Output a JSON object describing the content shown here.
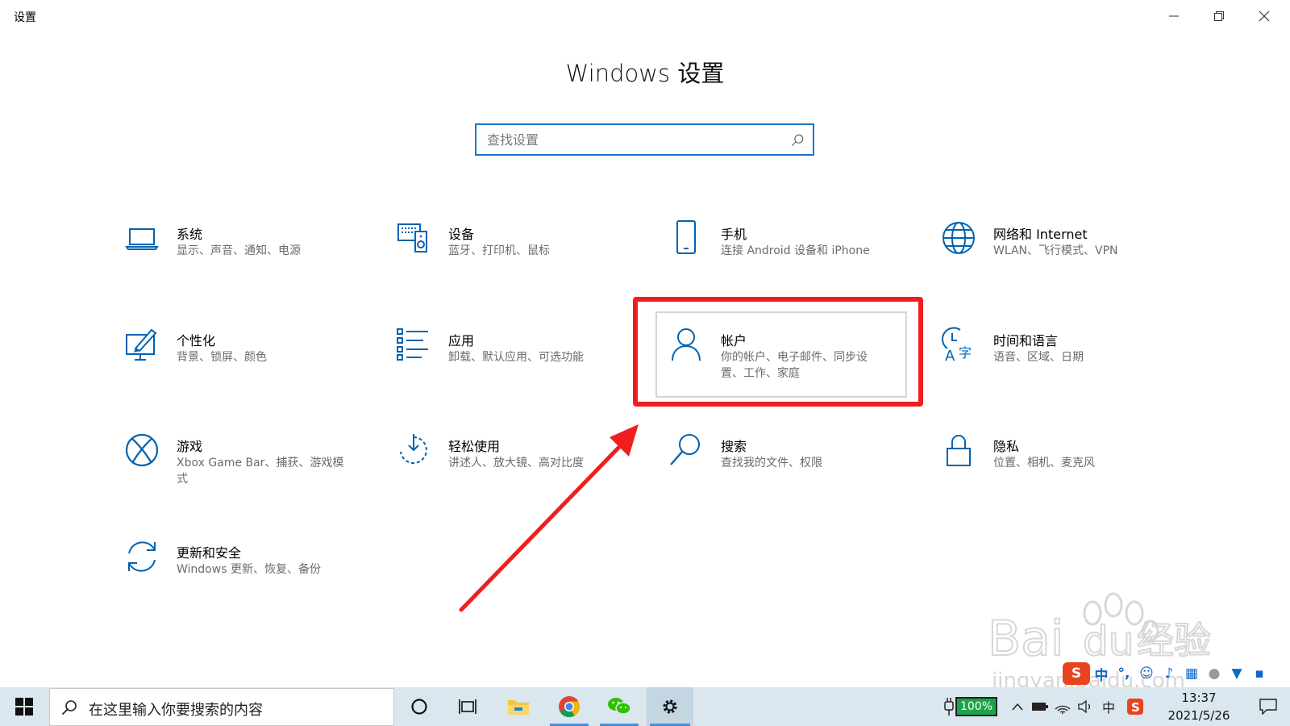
{
  "window": {
    "title": "设置",
    "minimize_icon": "minimize-icon",
    "restore_icon": "restore-icon",
    "close_icon": "close-icon"
  },
  "heading": "Windows 设置",
  "search": {
    "placeholder": "查找设置"
  },
  "tiles": [
    {
      "name": "系统",
      "desc": "显示、声音、通知、电源",
      "icon": "laptop-icon"
    },
    {
      "name": "设备",
      "desc": "蓝牙、打印机、鼠标",
      "icon": "devices-icon"
    },
    {
      "name": "手机",
      "desc": "连接 Android 设备和 iPhone",
      "icon": "phone-icon"
    },
    {
      "name": "网络和 Internet",
      "desc": "WLAN、飞行模式、VPN",
      "icon": "globe-icon"
    },
    {
      "name": "个性化",
      "desc": "背景、锁屏、颜色",
      "icon": "personalization-icon"
    },
    {
      "name": "应用",
      "desc": "卸载、默认应用、可选功能",
      "icon": "apps-list-icon"
    },
    {
      "name": "帐户",
      "desc": "你的帐户、电子邮件、同步设置、工作、家庭",
      "icon": "person-icon"
    },
    {
      "name": "时间和语言",
      "desc": "语音、区域、日期",
      "icon": "time-language-icon"
    },
    {
      "name": "游戏",
      "desc": "Xbox Game Bar、捕获、游戏模式",
      "icon": "xbox-icon"
    },
    {
      "name": "轻松使用",
      "desc": "讲述人、放大镜、高对比度",
      "icon": "ease-of-access-icon"
    },
    {
      "name": "搜索",
      "desc": "查找我的文件、权限",
      "icon": "search-icon"
    },
    {
      "name": "隐私",
      "desc": "位置、相机、麦克风",
      "icon": "lock-icon"
    },
    {
      "name": "更新和安全",
      "desc": "Windows 更新、恢复、备份",
      "icon": "update-icon"
    }
  ],
  "watermark": {
    "brand": "Bai",
    "brand2": "du",
    "cn": "经验",
    "url": "jingyan.baidu.com"
  },
  "taskbar": {
    "search_text": "在这里输入你要搜索的内容",
    "battery": "100%",
    "input_lang": "中",
    "time": "13:37",
    "date": "2021/5/26",
    "ime_lang": "中"
  },
  "colors": {
    "accent": "#0063b1",
    "highlight": "#f01e1e",
    "taskbar": "#dbe7ee"
  }
}
